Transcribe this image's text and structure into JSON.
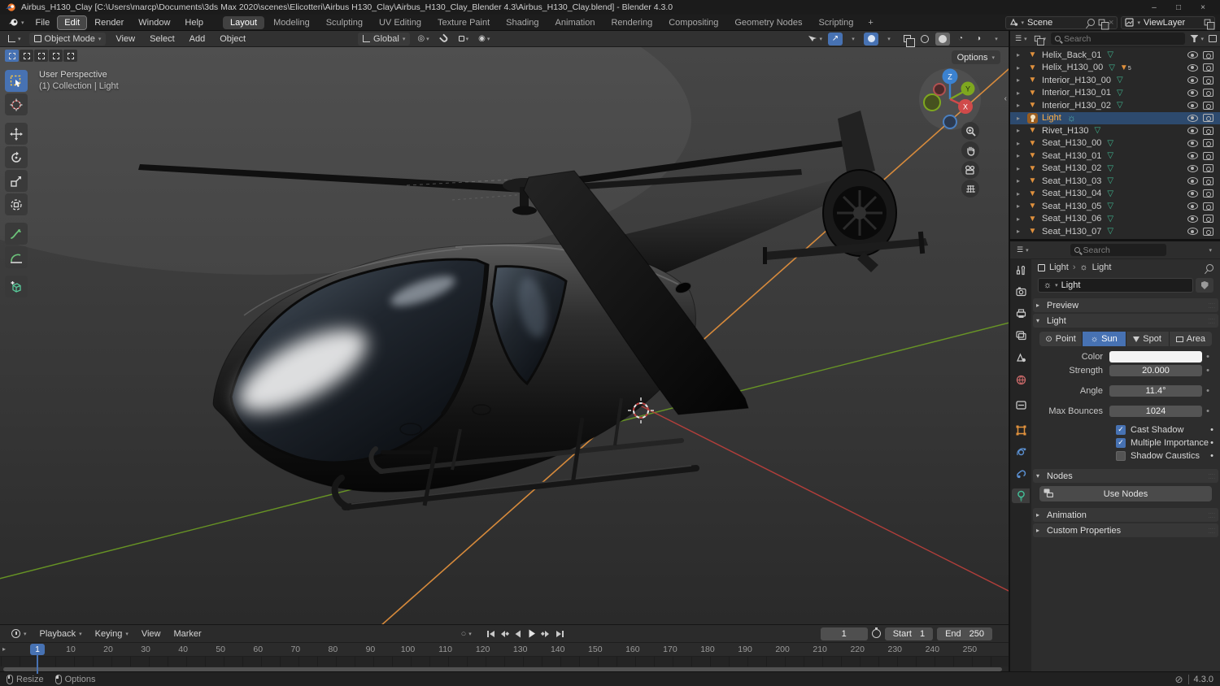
{
  "window": {
    "title": "Airbus_H130_Clay [C:\\Users\\marcp\\Documents\\3ds Max 2020\\scenes\\Elicotteri\\Airbus H130_Clay\\Airbus_H130_Clay_Blender 4.3\\Airbus_H130_Clay.blend] - Blender 4.3.0",
    "controls": {
      "minimize": "–",
      "maximize": "□",
      "close": "×"
    }
  },
  "menubar": {
    "menus": [
      "File",
      "Edit",
      "Render",
      "Window",
      "Help"
    ],
    "highlighted_menu": "Edit",
    "workspaces": [
      "Layout",
      "Modeling",
      "Sculpting",
      "UV Editing",
      "Texture Paint",
      "Shading",
      "Animation",
      "Rendering",
      "Compositing",
      "Geometry Nodes",
      "Scripting"
    ],
    "active_workspace": "Layout",
    "add_workspace": "+",
    "scene": {
      "label": "Scene",
      "close": "×"
    },
    "view_layer": {
      "label": "ViewLayer"
    }
  },
  "viewport": {
    "header": {
      "mode": "Object Mode",
      "menus": [
        "View",
        "Select",
        "Add",
        "Object"
      ],
      "orientation": "Global"
    },
    "overlay": {
      "view_label": "User Perspective",
      "context_label": "(1) Collection | Light",
      "options_button": "Options"
    },
    "gizmo": {
      "x": "X",
      "y": "Y",
      "z": "Z"
    }
  },
  "outliner": {
    "search_placeholder": "Search",
    "items": [
      {
        "name": "Helix_Back_01",
        "type": "mesh"
      },
      {
        "name": "Helix_H130_00",
        "type": "mesh",
        "badge": "5"
      },
      {
        "name": "Interior_H130_00",
        "type": "mesh"
      },
      {
        "name": "Interior_H130_01",
        "type": "mesh"
      },
      {
        "name": "Interior_H130_02",
        "type": "mesh"
      },
      {
        "name": "Light",
        "type": "light",
        "selected": true
      },
      {
        "name": "Rivet_H130",
        "type": "mesh"
      },
      {
        "name": "Seat_H130_00",
        "type": "mesh"
      },
      {
        "name": "Seat_H130_01",
        "type": "mesh"
      },
      {
        "name": "Seat_H130_02",
        "type": "mesh"
      },
      {
        "name": "Seat_H130_03",
        "type": "mesh"
      },
      {
        "name": "Seat_H130_04",
        "type": "mesh"
      },
      {
        "name": "Seat_H130_05",
        "type": "mesh"
      },
      {
        "name": "Seat_H130_06",
        "type": "mesh"
      },
      {
        "name": "Seat_H130_07",
        "type": "mesh"
      }
    ]
  },
  "properties": {
    "search_placeholder": "Search",
    "breadcrumb": {
      "object": "Light",
      "data": "Light"
    },
    "name_field": "Light",
    "preview_panel": "Preview",
    "light_panel": {
      "title": "Light",
      "types": [
        "Point",
        "Sun",
        "Spot",
        "Area"
      ],
      "active_type": "Sun",
      "color_label": "Color",
      "strength_label": "Strength",
      "strength": "20.000",
      "angle_label": "Angle",
      "angle": "11.4°",
      "max_bounces_label": "Max Bounces",
      "max_bounces": "1024",
      "cast_shadow": {
        "label": "Cast Shadow",
        "checked": true
      },
      "multiple_importance": {
        "label": "Multiple Importance",
        "checked": true
      },
      "shadow_caustics": {
        "label": "Shadow Caustics",
        "checked": false
      }
    },
    "nodes_panel": {
      "title": "Nodes",
      "use_nodes_button": "Use Nodes"
    },
    "animation_panel": "Animation",
    "custom_properties_panel": "Custom Properties"
  },
  "timeline": {
    "menus": [
      "Playback",
      "Keying",
      "View",
      "Marker"
    ],
    "current_frame": "1",
    "playhead_frame": "1",
    "start_label": "Start",
    "start": "1",
    "end_label": "End",
    "end": "250",
    "ruler_ticks": [
      10,
      20,
      30,
      40,
      50,
      60,
      70,
      80,
      90,
      100,
      110,
      120,
      130,
      140,
      150,
      160,
      170,
      180,
      190,
      200,
      210,
      220,
      230,
      240,
      250
    ]
  },
  "status_bar": {
    "resize": "Resize",
    "options": "Options",
    "version": "4.3.0"
  },
  "colors": {
    "accent": "#4772b3",
    "object_orange": "#e0913d",
    "mesh_data_green": "#3fb58f",
    "axis_x_red": "#c0403c",
    "axis_y_green": "#71a523",
    "light_line_orange": "#e08f3c",
    "selected_row": "#2d4a6e",
    "active_text_orange": "#ffaf45"
  }
}
